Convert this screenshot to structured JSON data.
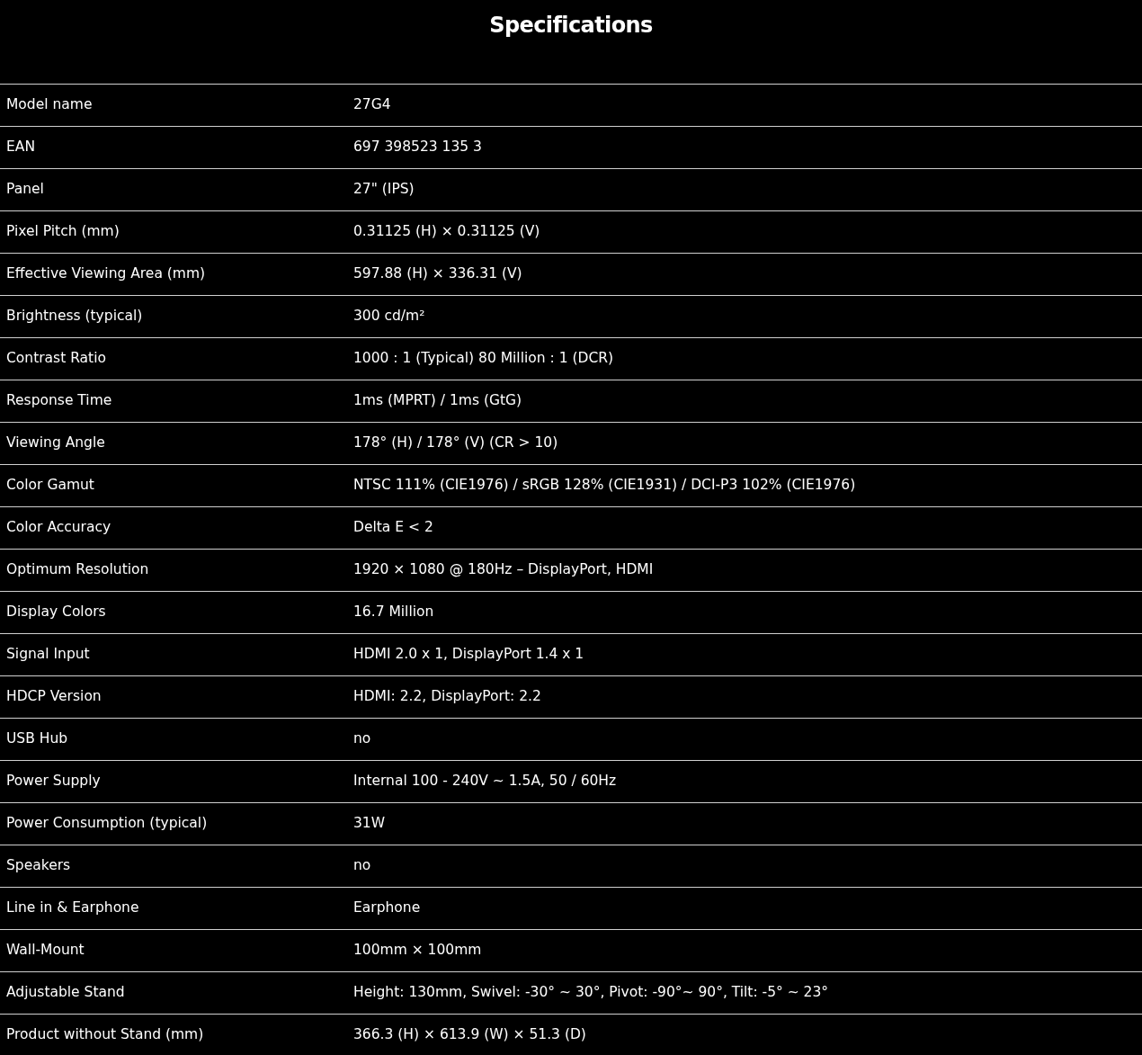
{
  "title": "Specifications",
  "rows": [
    {
      "label": "Model name",
      "value": "27G4"
    },
    {
      "label": "EAN",
      "value": "697 398523 135 3"
    },
    {
      "label": "Panel",
      "value": "27\" (IPS)"
    },
    {
      "label": "Pixel Pitch (mm)",
      "value": "0.31125 (H) × 0.31125 (V)"
    },
    {
      "label": "Effective Viewing Area (mm)",
      "value": "597.88 (H) × 336.31 (V)"
    },
    {
      "label": "Brightness (typical)",
      "value": "300 cd/m²"
    },
    {
      "label": "Contrast Ratio",
      "value": "1000 : 1 (Typical) 80 Million : 1 (DCR)"
    },
    {
      "label": "Response Time",
      "value": "1ms (MPRT) / 1ms (GtG)"
    },
    {
      "label": "Viewing Angle",
      "value": "178° (H) / 178° (V) (CR > 10)"
    },
    {
      "label": "Color Gamut",
      "value": "NTSC 111% (CIE1976) / sRGB 128% (CIE1931) / DCI-P3 102% (CIE1976)"
    },
    {
      "label": "Color Accuracy",
      "value": "Delta E < 2"
    },
    {
      "label": "Optimum Resolution",
      "value": "1920 × 1080 @ 180Hz – DisplayPort, HDMI"
    },
    {
      "label": "Display Colors",
      "value": "16.7 Million"
    },
    {
      "label": "Signal Input",
      "value": "HDMI 2.0 x 1, DisplayPort 1.4 x 1"
    },
    {
      "label": "HDCP Version",
      "value": "HDMI: 2.2, DisplayPort: 2.2"
    },
    {
      "label": "USB Hub",
      "value": "no"
    },
    {
      "label": "Power Supply",
      "value": "Internal 100 - 240V ~ 1.5A, 50 / 60Hz"
    },
    {
      "label": "Power Consumption (typical)",
      "value": "31W"
    },
    {
      "label": "Speakers",
      "value": "no"
    },
    {
      "label": "Line in & Earphone",
      "value": "Earphone"
    },
    {
      "label": "Wall-Mount",
      "value": "100mm × 100mm"
    },
    {
      "label": "Adjustable Stand",
      "value": "Height: 130mm, Swivel: -30° ~ 30°, Pivot: -90°~ 90°, Tilt: -5° ~ 23°"
    },
    {
      "label": "Product without Stand (mm)",
      "value": "366.3 (H) × 613.9 (W) × 51.3 (D)"
    }
  ]
}
